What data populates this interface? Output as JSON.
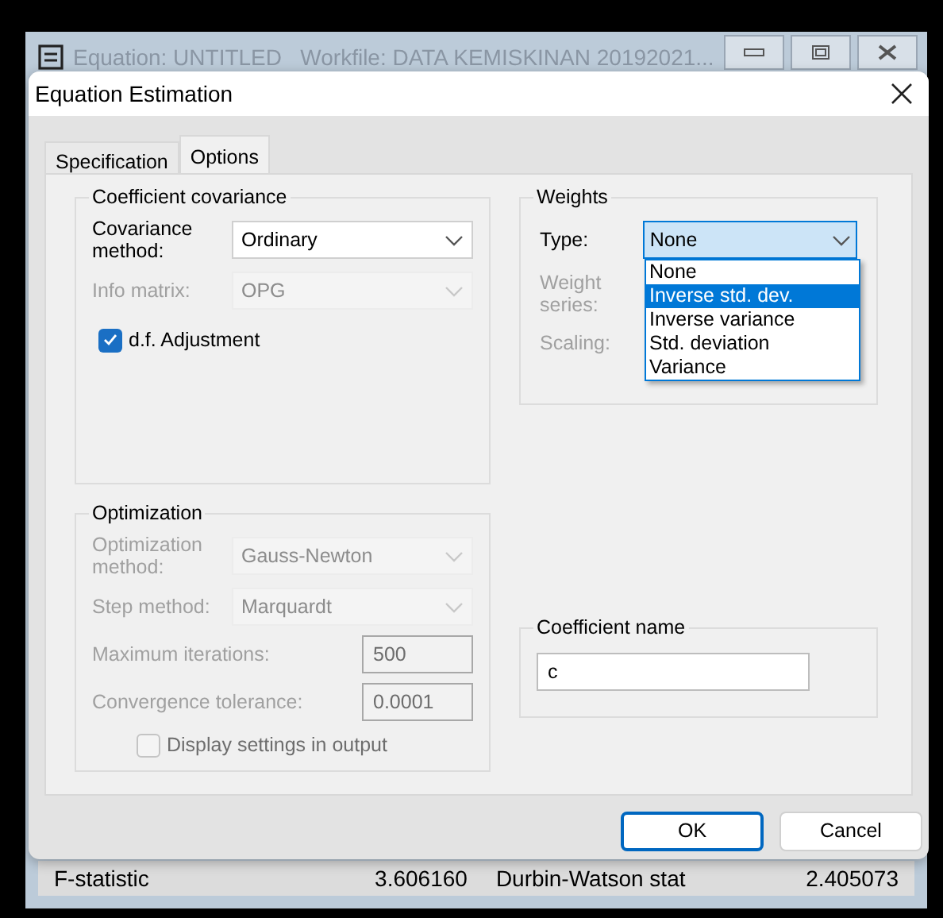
{
  "background_window": {
    "title": "Equation: UNTITLED   Workfile: DATA KEMISKINAN 20192021...",
    "stats_row": [
      "F-statistic",
      "3.606160",
      "Durbin-Watson stat",
      "2.405073"
    ]
  },
  "dialog": {
    "title": "Equation Estimation",
    "tabs": [
      {
        "label": "Specification",
        "selected": false
      },
      {
        "label": "Options",
        "selected": true
      }
    ],
    "coefficient_covariance": {
      "title": "Coefficient covariance",
      "fields": [
        {
          "kind": "dropdown",
          "label": "Covariance method:",
          "value": "Ordinary",
          "disabled": false
        },
        {
          "kind": "dropdown",
          "label": "Info matrix:",
          "value": "OPG",
          "disabled": true
        }
      ],
      "df_adjustment": {
        "label": "d.f. Adjustment",
        "checked": true,
        "disabled": false
      }
    },
    "optimization": {
      "title": "Optimization",
      "fields": [
        {
          "kind": "dropdown",
          "label": "Optimization method:",
          "value": "Gauss-Newton",
          "disabled": true
        },
        {
          "kind": "dropdown",
          "label": "Step method:",
          "value": "Marquardt",
          "disabled": true
        },
        {
          "kind": "text",
          "label": "Maximum iterations:",
          "value": "500",
          "disabled": true
        },
        {
          "kind": "text",
          "label": "Convergence tolerance:",
          "value": "0.0001",
          "disabled": true
        }
      ],
      "display_settings": {
        "label": "Display settings in output",
        "checked": false,
        "disabled": true
      }
    },
    "weights": {
      "title": "Weights",
      "type": {
        "label": "Type:",
        "value": "None",
        "expanded": true,
        "options": [
          {
            "label": "None",
            "highlighted": false
          },
          {
            "label": "Inverse std. dev.",
            "highlighted": true
          },
          {
            "label": "Inverse variance",
            "highlighted": false
          },
          {
            "label": "Std. deviation",
            "highlighted": false
          },
          {
            "label": "Variance",
            "highlighted": false
          }
        ]
      },
      "weight_series": {
        "label": "Weight series:"
      },
      "scaling": {
        "label": "Scaling:"
      }
    },
    "coefficient_name": {
      "title": "Coefficient name",
      "value": "c"
    },
    "buttons": [
      {
        "label": "OK",
        "default": true
      },
      {
        "label": "Cancel",
        "default": false
      }
    ]
  }
}
